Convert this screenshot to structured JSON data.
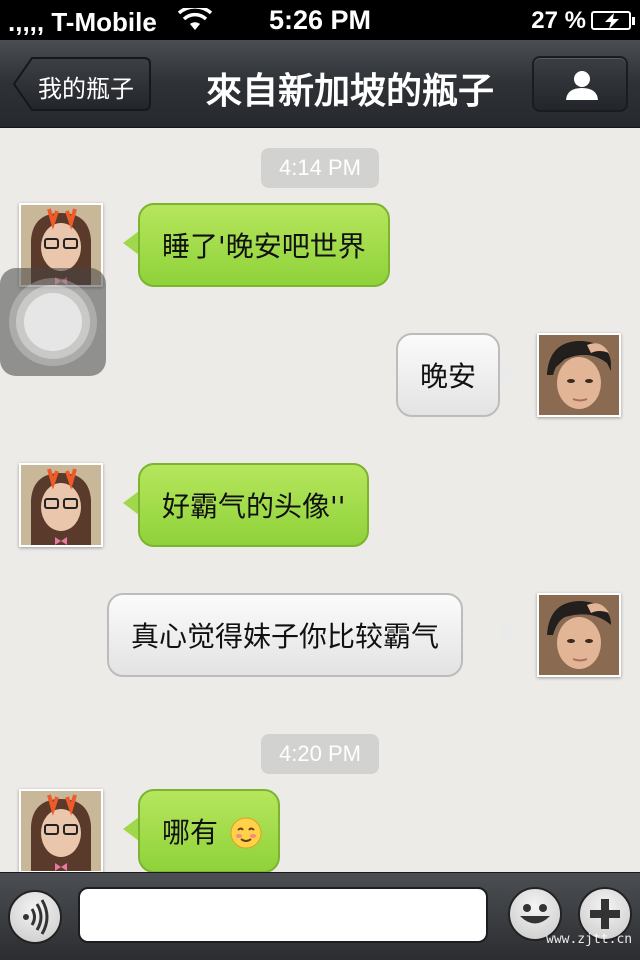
{
  "status_bar": {
    "signal": ".,,,,  T-Mobile",
    "time": "5:26 PM",
    "battery": "27 %"
  },
  "nav": {
    "back_label": "我的瓶子",
    "title": "來自新加坡的瓶子",
    "profile_icon": "person-icon"
  },
  "chat": {
    "timestamps": [
      "4:14 PM",
      "4:20 PM"
    ],
    "messages": [
      {
        "from": "other",
        "text": "睡了'晚安吧世界"
      },
      {
        "from": "me",
        "text": "晚安"
      },
      {
        "from": "other",
        "text": "好霸气的头像''"
      },
      {
        "from": "me",
        "text": "真心觉得妹子你比较霸气"
      },
      {
        "from": "other",
        "text": "哪有",
        "emoji": "smiley-blush-icon"
      }
    ]
  },
  "input_bar": {
    "voice_icon": "voice-icon",
    "emoji_icon": "emoji-icon",
    "plus_icon": "plus-icon",
    "text_value": ""
  },
  "watermark": "www.zjtt.cn",
  "colors": {
    "green_bubble": "#9fd84a",
    "gray_bubble": "#efefef",
    "nav_bar": "#2e3135"
  }
}
